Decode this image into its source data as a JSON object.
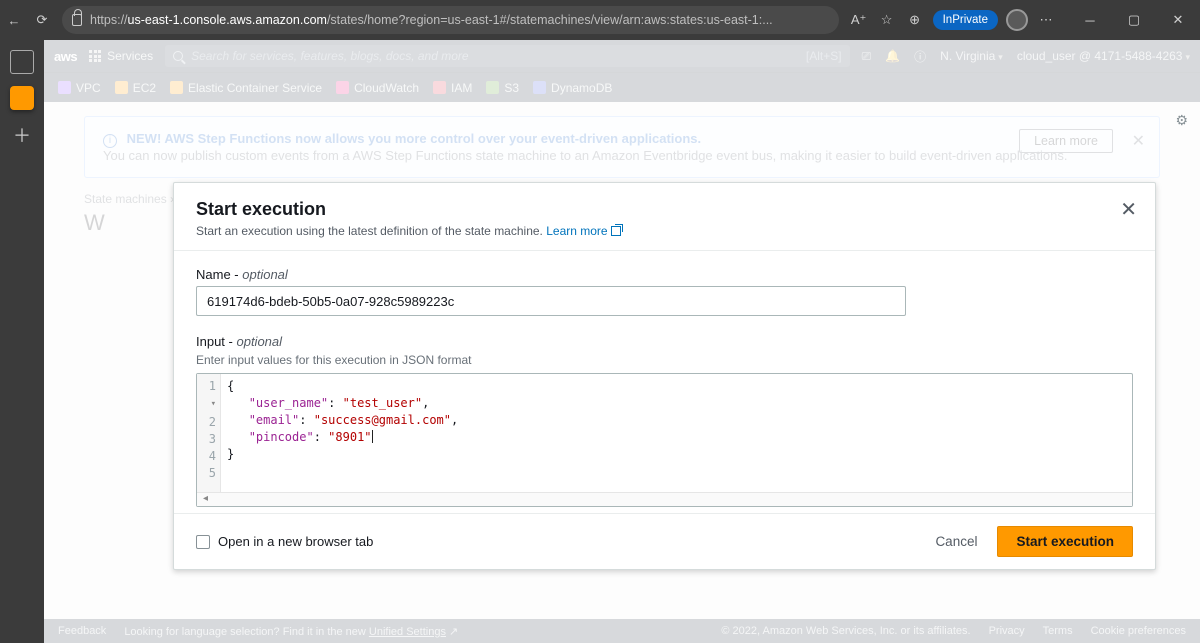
{
  "browser": {
    "url_host": "us-east-1.console.aws.amazon.com",
    "url_path": "/states/home?region=us-east-1#/statemachines/view/arn:aws:states:us-east-1:...",
    "inprivate": "InPrivate",
    "reader": "A⁺"
  },
  "aws_header": {
    "logo": "aws",
    "services": "Services",
    "search_placeholder": "Search for services, features, blogs, docs, and more",
    "search_shortcut": "[Alt+S]",
    "region": "N. Virginia",
    "user": "cloud_user @ 4171-5488-4263"
  },
  "service_bar": [
    "VPC",
    "EC2",
    "Elastic Container Service",
    "CloudWatch",
    "IAM",
    "S3",
    "DynamoDB"
  ],
  "flash": {
    "headline": "NEW! AWS Step Functions now allows you more control over your event-driven applications.",
    "body": "You can now publish custom events from a AWS Step Functions state machine to an Amazon Eventbridge event bus, making it easier to build event-driven applications.",
    "learn_more": "Learn more"
  },
  "breadcrumb": "State machines › ",
  "page_heading_prefix": "W",
  "modal": {
    "title": "Start execution",
    "subtitle": "Start an execution using the latest definition of the state machine. ",
    "learn_more": "Learn more",
    "name_label": "Name",
    "optional": "optional",
    "name_value": "619174d6-bdeb-50b5-0a07-928c5989223c",
    "input_label": "Input",
    "input_hint": "Enter input values for this execution in JSON format",
    "json_lines": [
      {
        "n": "1",
        "type": "brace",
        "text": "{",
        "fold": true
      },
      {
        "n": "2",
        "type": "kv",
        "key": "\"user_name\"",
        "val": "\"test_user\"",
        "comma": true
      },
      {
        "n": "3",
        "type": "kv",
        "key": "\"email\"",
        "val": "\"success@gmail.com\"",
        "comma": true
      },
      {
        "n": "4",
        "type": "kv",
        "key": "\"pincode\"",
        "val": "\"8901\"",
        "caret": true
      },
      {
        "n": "5",
        "type": "brace",
        "text": "}"
      }
    ],
    "open_tab": "Open in a new browser tab",
    "cancel": "Cancel",
    "start": "Start execution"
  },
  "footer": {
    "feedback": "Feedback",
    "lang": "Looking for language selection? Find it in the new ",
    "lang_link": "Unified Settings",
    "copyright": "© 2022, Amazon Web Services, Inc. or its affiliates.",
    "privacy": "Privacy",
    "terms": "Terms",
    "cookies": "Cookie preferences"
  }
}
